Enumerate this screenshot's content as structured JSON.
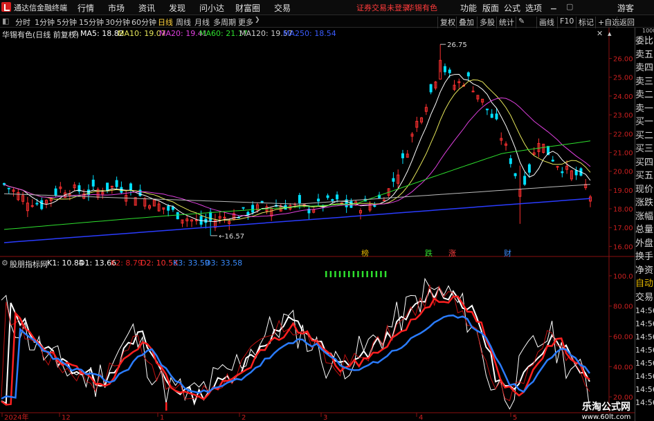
{
  "menu": {
    "app_title": "通达信金融终端",
    "items": [
      "行情",
      "市场",
      "资讯",
      "发现",
      "问小达",
      "财富圈",
      "交易"
    ],
    "notice": "证券交易未登录",
    "stock": "华锡有色",
    "right_items": [
      "功能",
      "版面",
      "公式",
      "选项"
    ],
    "guest": "游客"
  },
  "toolbar": {
    "periods": [
      "分时",
      "1分钟",
      "5分钟",
      "15分钟",
      "30分钟",
      "60分钟",
      "日线",
      "周线",
      "月线",
      "多周期",
      "更多"
    ],
    "active_period": "日线",
    "right_buttons": [
      "复权",
      "叠加",
      "多股",
      "统计",
      "画线",
      "F10",
      "标记",
      "+自选",
      "返回"
    ]
  },
  "main_chart": {
    "stock_label": "华锡有色(日线 前复权)",
    "ma": [
      {
        "label": "MA5: 18.82",
        "color": "#ffffff"
      },
      {
        "label": "MA10: 19.07",
        "color": "#e6e65a"
      },
      {
        "label": "MA20: 19.41",
        "color": "#e040e0"
      },
      {
        "label": "MA60: 21.17",
        "color": "#2ee02e"
      },
      {
        "label": "MA120: 19.57",
        "color": "#cccccc"
      },
      {
        "label": "MA250: 18.54",
        "color": "#3a5cff"
      }
    ],
    "high_label": "26.75",
    "low_label": "16.57",
    "y_ticks": [
      "26.00",
      "25.00",
      "24.00",
      "23.00",
      "22.00",
      "21.00",
      "20.00",
      "19.00",
      "18.00",
      "17.00",
      "16.00"
    ],
    "event_markers": [
      {
        "text": "榜",
        "color": "#e6b800"
      },
      {
        "text": "跌",
        "color": "#2ee02e"
      },
      {
        "text": "涨",
        "color": "#ff4040"
      },
      {
        "text": "财",
        "color": "#3a8cff"
      }
    ]
  },
  "indicator": {
    "name": "股朋指标网",
    "params": [
      {
        "label": "K1: 10.84",
        "color": "#ffffff"
      },
      {
        "label": "D1: 13.66",
        "color": "#ffffff"
      },
      {
        "label": "K2: 8.79",
        "color": "#e02020"
      },
      {
        "label": "D2: 10.58",
        "color": "#ff3030"
      },
      {
        "label": "K3: 33.59",
        "color": "#3a8cff"
      },
      {
        "label": "D3: 33.58",
        "color": "#3a8cff"
      }
    ],
    "y_ticks": [
      "100.0",
      "80.00",
      "60.00",
      "40.00",
      "20.00"
    ]
  },
  "time_axis": [
    "2024年",
    "12",
    "1",
    "2",
    "3",
    "4",
    "5"
  ],
  "side_panel": [
    "委比",
    "卖五",
    "卖四",
    "卖三",
    "卖二",
    "卖一",
    "买一",
    "买二",
    "买三",
    "买四",
    "买五",
    "现价",
    "涨跌",
    "涨幅",
    "总量",
    "外盘",
    "换手",
    "净资",
    "自动",
    "交易",
    "14:56",
    "14:56",
    "14:56",
    "14:56",
    "14:56",
    "14:56",
    "14:56",
    "14:56"
  ],
  "side_top": "1000",
  "watermark": {
    "line1": "乐淘公式网",
    "line2": "www.60lt.com"
  }
}
